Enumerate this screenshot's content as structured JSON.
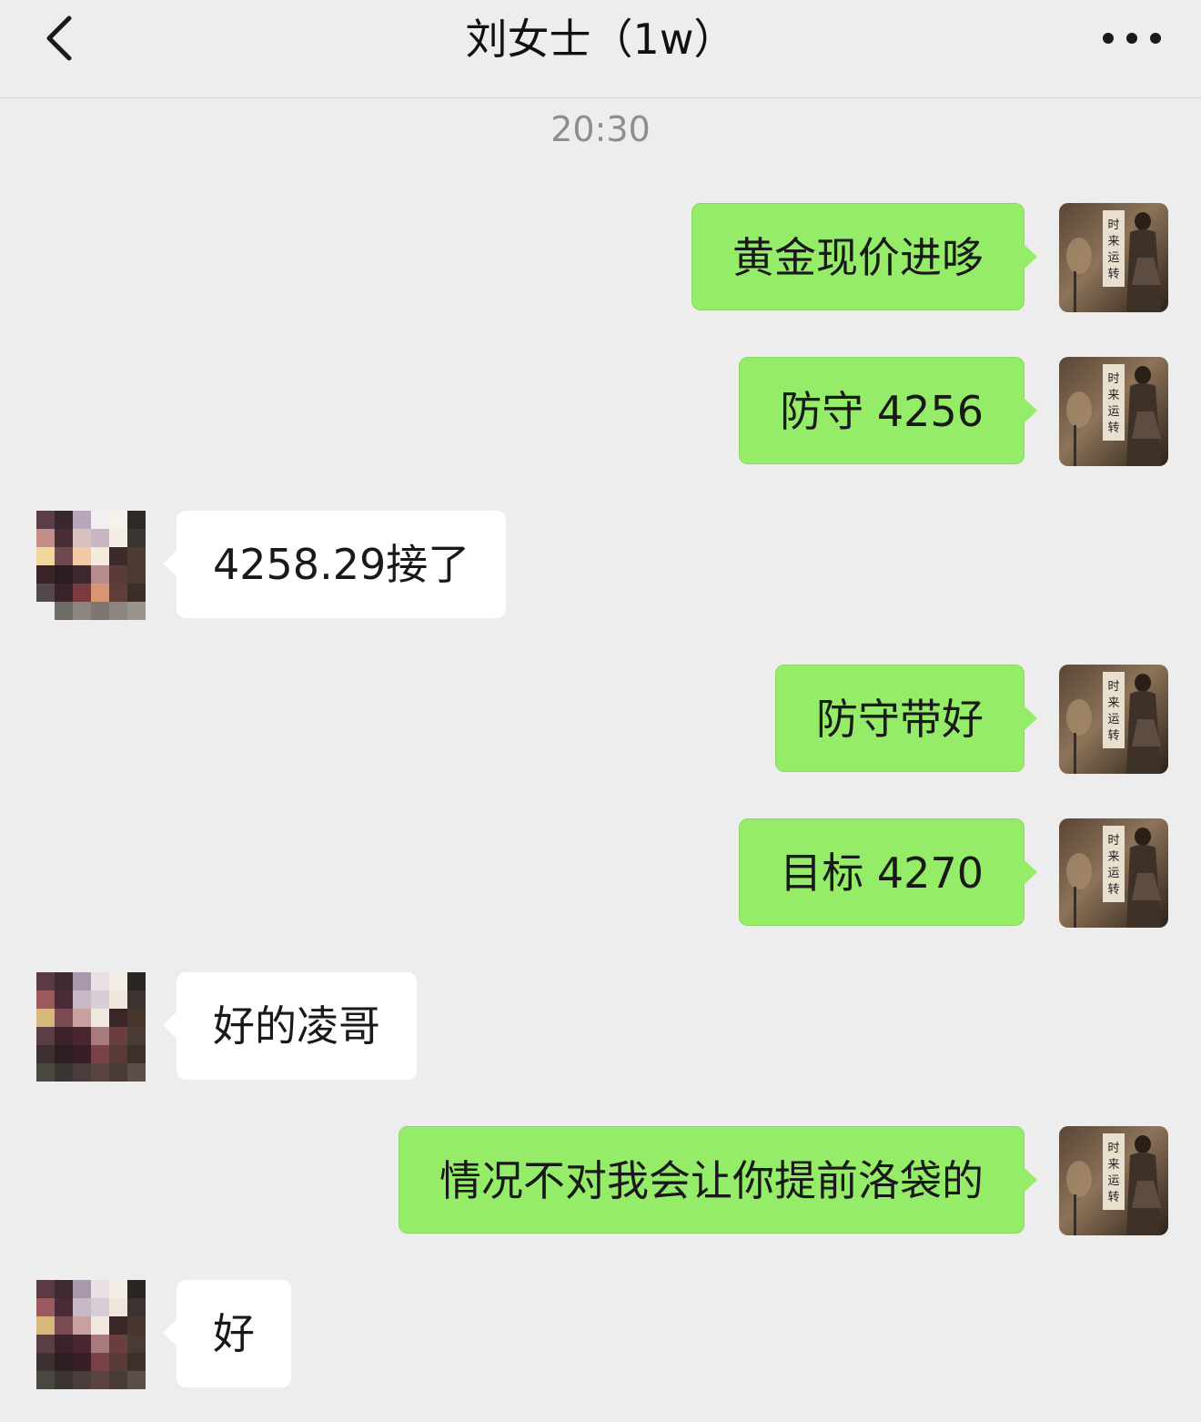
{
  "header": {
    "back_icon": "chevron-left-icon",
    "title": "刘女士（1w）",
    "more_icon": "more-dots-icon"
  },
  "timestamp": "20:30",
  "messages": [
    {
      "side": "out",
      "text": "黄金现价进哆"
    },
    {
      "side": "out",
      "text": "防守 4256"
    },
    {
      "side": "in",
      "text": "4258.29接了"
    },
    {
      "side": "out",
      "text": "防守带好"
    },
    {
      "side": "out",
      "text": "目标 4270"
    },
    {
      "side": "in",
      "text": "好的凌哥"
    },
    {
      "side": "out",
      "text": "情况不对我会让你提前洛袋的"
    },
    {
      "side": "in",
      "text": "好"
    }
  ],
  "colors": {
    "background": "#EDEDED",
    "outgoing_bubble": "#95EC69",
    "incoming_bubble": "#FFFFFF",
    "timestamp": "#8E8E8E"
  }
}
